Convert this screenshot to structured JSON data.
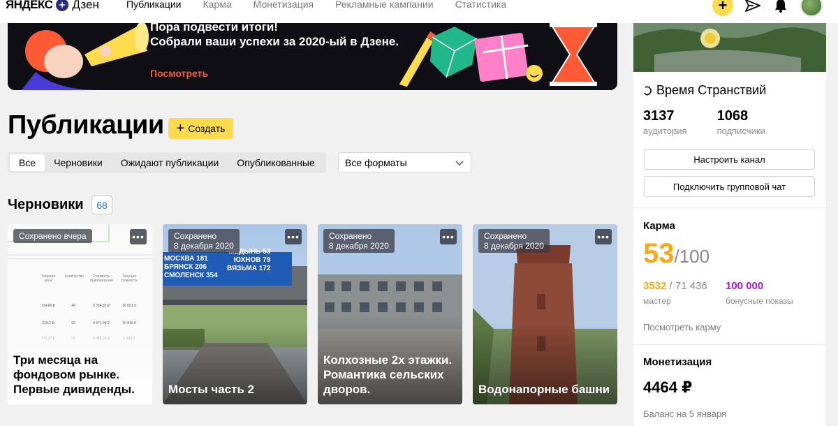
{
  "header": {
    "logo_ya": "ЯНДЕКС",
    "logo_zen": "Дзен",
    "nav": [
      "Публикации",
      "Карма",
      "Монетизация",
      "Рекламные кампании",
      "Статистика"
    ],
    "plus_label": "+"
  },
  "banner": {
    "line1": "Пора подвести итоги!",
    "line2": "Собрали ваши успехи за 2020-ый в Дзене.",
    "link": "Посмотреть"
  },
  "main": {
    "title": "Публикации",
    "create_label": "Создать",
    "tabs": [
      "Все",
      "Черновики",
      "Ожидают публикации",
      "Опубликованные"
    ],
    "format_select": "Все форматы",
    "drafts_title": "Черновики",
    "drafts_count": "68"
  },
  "cards": [
    {
      "badge": "Сохранено вчера",
      "title": "Три месяца на фондовом рынке. Первые дивиденды."
    },
    {
      "badge_line1": "Сохранено",
      "badge_line2": "8 декабря 2020",
      "title": "Мосты часть 2"
    },
    {
      "badge_line1": "Сохранено",
      "badge_line2": "8 декабря 2020",
      "title": "Колхозные 2х этажки. Романтика сельских дворов."
    },
    {
      "badge_line1": "Сохранено",
      "badge_line2": "8 декабря 2020",
      "title": "Водонапорные башни"
    }
  ],
  "card1_table": {
    "headers": [
      "Текущая цена",
      "Количество",
      "Стоимость приобретения",
      "Текущая стоимость"
    ],
    "rows": [
      [
        "214,69 ₽",
        "40",
        "6 534,33 ₽",
        "16 091,9"
      ],
      [
        "216,2 ₽",
        "50",
        "9 871,05 ₽",
        "10 810,0"
      ],
      [
        "273,37 ₽",
        "25",
        "6 449,29 ₽",
        "6 934,2"
      ]
    ]
  },
  "card2_sign": {
    "left": [
      "МОСКВА 181",
      "БРЯНСК 206",
      "СМОЛЕНСК 354"
    ],
    "right": [
      "МЕДЫНЬ 53",
      "ЮХНОВ 79",
      "ВЯЗЬМА 172"
    ]
  },
  "sidebar": {
    "channel_name": "Время Странствий",
    "audience_value": "3137",
    "audience_label": "аудитория",
    "subscribers_value": "1068",
    "subscribers_label": "подписчики",
    "btn_setup": "Настроить канал",
    "btn_chat": "Подключить групповой чат",
    "karma_title": "Карма",
    "karma_value": "53",
    "karma_max": "/100",
    "karma_points": "3532",
    "karma_points_total": " / 71 436",
    "karma_level": "мастер",
    "bonus_value": "100 000",
    "bonus_label": "бонусные показы",
    "see_karma": "Посмотреть карму",
    "monetization_title": "Монетизация",
    "balance": "4464 ₽",
    "balance_label": "Баланс на 5 января"
  },
  "colors": {
    "accent_yellow": "#ffdb4d",
    "karma_orange": "#f4a91b",
    "bonus_purple": "#a91bd6",
    "link_blue": "#2a6fd6",
    "banner_link": "#ff5a36"
  }
}
